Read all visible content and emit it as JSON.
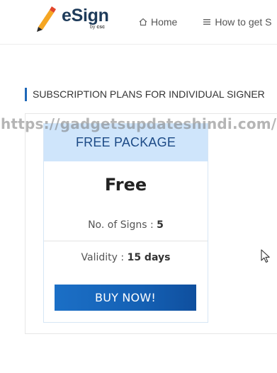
{
  "header": {
    "logo": {
      "brand": "eSign",
      "by_label": "by",
      "org_label": "csc"
    },
    "nav": [
      {
        "label": "Home",
        "icon": "home-icon"
      },
      {
        "label": "How to get S",
        "icon": "list-icon"
      }
    ]
  },
  "section": {
    "title": "SUBSCRIPTION PLANS FOR INDIVIDUAL SIGNER"
  },
  "watermark": "https://gadgetsupdateshindi.com/",
  "plan": {
    "name": "FREE PACKAGE",
    "price": "Free",
    "signs_label": "No. of Signs :",
    "signs_value": "5",
    "validity_label": "Validity :",
    "validity_value": "15 days",
    "cta_label": "BUY NOW!"
  },
  "colors": {
    "accent": "#1f68b8",
    "card_header_bg": "#cfe5fb",
    "card_header_text": "#1c4a86",
    "button": "#1565c0",
    "brand_text": "#1e3b5a",
    "logo_orange": "#f5a623",
    "logo_red": "#e2462b"
  }
}
